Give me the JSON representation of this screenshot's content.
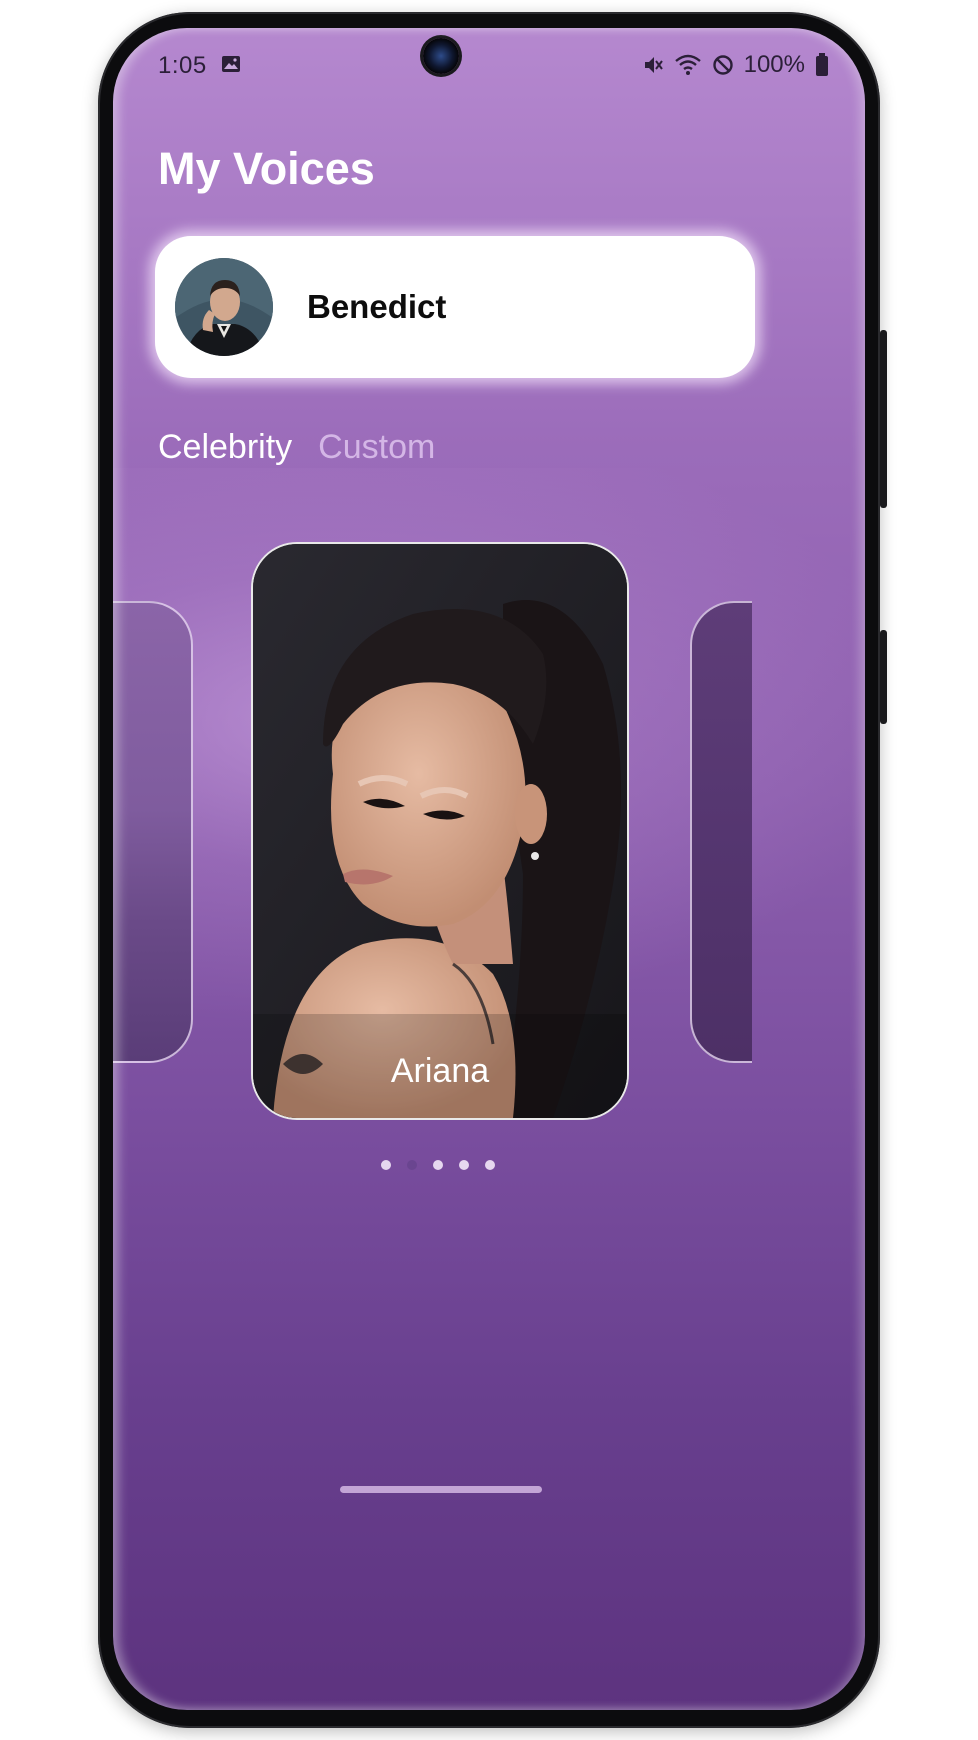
{
  "status_bar": {
    "time": "1:05",
    "battery_percent": "100%",
    "icons": [
      "image-icon",
      "mute-icon",
      "wifi-icon",
      "do-not-disturb-icon",
      "battery-icon"
    ]
  },
  "page": {
    "title": "My Voices"
  },
  "selected_voice": {
    "name": "Benedict"
  },
  "tabs": [
    {
      "label": "Celebrity",
      "active": true
    },
    {
      "label": "Custom",
      "active": false
    }
  ],
  "carousel": {
    "current_card": {
      "label": "Ariana"
    },
    "page_count": 5,
    "active_index": 1
  },
  "colors": {
    "background_top": "#b588cf",
    "background_bottom": "#5d337f",
    "tab_inactive": "#d4b6e6",
    "dot_active": "#6a4590"
  }
}
